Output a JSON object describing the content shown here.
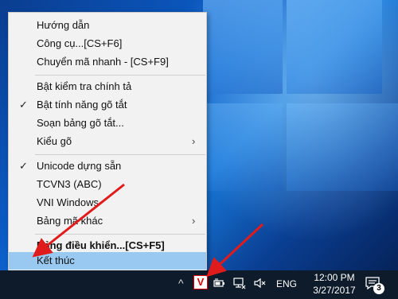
{
  "menu": {
    "items": [
      {
        "label": "Hướng dẫn",
        "checked": false,
        "submenu": false,
        "bold": false,
        "highlighted": false
      },
      {
        "label": "Công cụ...[CS+F6]",
        "checked": false,
        "submenu": false,
        "bold": false,
        "highlighted": false
      },
      {
        "label": "Chuyển mã nhanh - [CS+F9]",
        "checked": false,
        "submenu": false,
        "bold": false,
        "highlighted": false
      },
      {
        "label": "Bật kiểm tra chính tả",
        "checked": false,
        "submenu": false,
        "bold": false,
        "highlighted": false
      },
      {
        "label": "Bật tính năng gõ tắt",
        "checked": true,
        "submenu": false,
        "bold": false,
        "highlighted": false
      },
      {
        "label": "Soạn bảng gõ tắt...",
        "checked": false,
        "submenu": false,
        "bold": false,
        "highlighted": false
      },
      {
        "label": "Kiểu gõ",
        "checked": false,
        "submenu": true,
        "bold": false,
        "highlighted": false
      },
      {
        "label": "Unicode dựng sẵn",
        "checked": true,
        "submenu": false,
        "bold": false,
        "highlighted": false
      },
      {
        "label": "TCVN3 (ABC)",
        "checked": false,
        "submenu": false,
        "bold": false,
        "highlighted": false
      },
      {
        "label": "VNI Windows",
        "checked": false,
        "submenu": false,
        "bold": false,
        "highlighted": false
      },
      {
        "label": "Bảng mã khác",
        "checked": false,
        "submenu": true,
        "bold": false,
        "highlighted": false
      },
      {
        "label": "Bảng điều khiển...[CS+F5]",
        "checked": false,
        "submenu": false,
        "bold": true,
        "highlighted": false
      },
      {
        "label": "Kết thúc",
        "checked": false,
        "submenu": false,
        "bold": false,
        "highlighted": true
      }
    ],
    "check_glyph": "✓",
    "submenu_glyph": "›"
  },
  "taskbar": {
    "chevron": "^",
    "unikey_letter": "V",
    "language": "ENG",
    "time": "12:00 PM",
    "date": "3/27/2017",
    "notification_count": "3",
    "icons": [
      "show-hidden-icons-icon",
      "unikey-tray-icon",
      "battery-icon",
      "network-icon",
      "volume-muted-icon",
      "notification-center-icon"
    ]
  },
  "colors": {
    "highlight": "#99c9f0",
    "taskbar": "#0d1b2a",
    "arrow": "#e01b1b",
    "menu_bg": "#f2f2f2"
  }
}
